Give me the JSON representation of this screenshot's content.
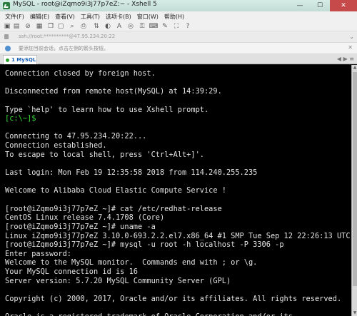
{
  "window": {
    "title": "MySQL - root@iZqmo9i3j77p7eZ:~ - Xshell 5",
    "controls": {
      "minimize": "—",
      "maximize": "☐",
      "close": "✕"
    }
  },
  "menu": [
    "文件(F)",
    "编辑(E)",
    "查看(V)",
    "工具(T)",
    "选项卡(B)",
    "窗口(W)",
    "帮助(H)"
  ],
  "address": {
    "text": "ssh://root:**********@47.95.234.20:22",
    "right_label": "⌄"
  },
  "hint": {
    "text": "要添加当前会话，点击左侧的箭头按钮。",
    "close": "✕"
  },
  "tab": {
    "label": "1 MySQL",
    "arrows": "◀ ▶ ≡"
  },
  "terminal": {
    "lines": [
      "Connection closed by foreign host.",
      "",
      "Disconnected from remote host(MySQL) at 14:39:29.",
      "",
      "Type `help' to learn how to use Xshell prompt.",
      "[c:\\~]$",
      "",
      "Connecting to 47.95.234.20:22...",
      "Connection established.",
      "To escape to local shell, press 'Ctrl+Alt+]'.",
      "",
      "Last login: Mon Feb 19 12:35:58 2018 from 114.240.255.235",
      "",
      "Welcome to Alibaba Cloud Elastic Compute Service !",
      "",
      "[root@iZqmo9i3j77p7eZ ~]# cat /etc/redhat-release",
      "CentOS Linux release 7.4.1708 (Core)",
      "[root@iZqmo9i3j77p7eZ ~]# uname -a",
      "Linux iZqmo9i3j77p7eZ 3.10.0-693.2.2.el7.x86_64 #1 SMP Tue Sep 12 22:26:13 UTC 2",
      "[root@iZqmo9i3j77p7eZ ~]# mysql -u root -h localhost -P 3306 -p",
      "Enter password:",
      "Welcome to the MySQL monitor.  Commands end with ; or \\g.",
      "Your MySQL connection id is 16",
      "Server version: 5.7.20 MySQL Community Server (GPL)",
      "",
      "Copyright (c) 2000, 2017, Oracle and/or its affiliates. All rights reserved.",
      "",
      "Oracle is a registered trademark of Oracle Corporation and/or its"
    ],
    "prompt_color": "#35e035",
    "text_color": "#e4e4e4",
    "background": "#000000"
  },
  "toolbar_icons": [
    "new-session-icon",
    "open-folder-icon",
    "disconnect-icon",
    "properties-icon",
    "copy-icon",
    "paste-icon",
    "find-icon",
    "print-icon",
    "sftp-icon",
    "color-scheme-icon",
    "font-icon",
    "globe-icon",
    "lock-icon",
    "keyboard-icon",
    "compose-icon",
    "fullscreen-icon",
    "help-icon"
  ]
}
